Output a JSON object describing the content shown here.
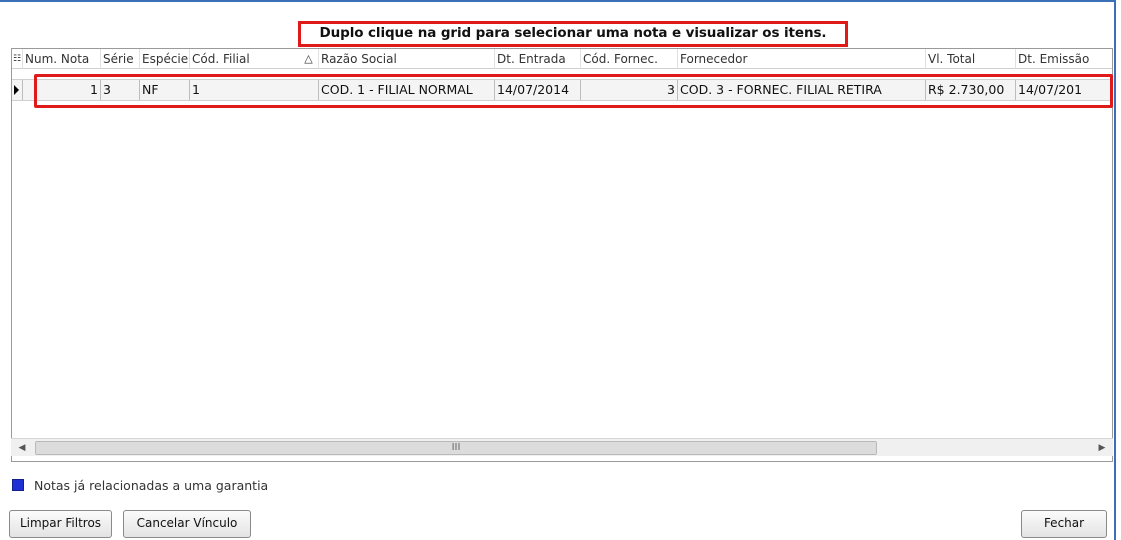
{
  "instruction": "Duplo clique na grid para selecionar uma nota e visualizar os itens.",
  "grid": {
    "columns": [
      {
        "key": "sel",
        "label": "☷"
      },
      {
        "key": "num_nota",
        "label": "Num. Nota"
      },
      {
        "key": "serie",
        "label": "Série"
      },
      {
        "key": "especie",
        "label": "Espécie"
      },
      {
        "key": "cod_filial",
        "label": "Cód. Filial"
      },
      {
        "key": "sort_indicator",
        "label": "△"
      },
      {
        "key": "razao_social",
        "label": "Razão Social"
      },
      {
        "key": "dt_entrada",
        "label": "Dt. Entrada"
      },
      {
        "key": "cod_fornec",
        "label": "Cód. Fornec."
      },
      {
        "key": "fornecedor",
        "label": "Fornecedor"
      },
      {
        "key": "vl_total",
        "label": "Vl. Total"
      },
      {
        "key": "dt_emissao",
        "label": "Dt. Emissão"
      }
    ],
    "rows": [
      {
        "num_nota": "1",
        "serie": "3",
        "especie": "NF",
        "cod_filial": "1",
        "razao_social": "COD. 1 - FILIAL NORMAL",
        "dt_entrada": "14/07/2014",
        "cod_fornec": "3",
        "fornecedor": "COD. 3 - FORNEC. FILIAL RETIRA",
        "vl_total": "R$ 2.730,00",
        "dt_emissao": "14/07/201"
      }
    ]
  },
  "scrollbar": {
    "thumb_glyph": "III",
    "left_glyph": "◀",
    "right_glyph": "▶"
  },
  "legend": {
    "label": "Notas já relacionadas a uma garantia",
    "color": "#1f2fd1"
  },
  "buttons": {
    "limpar_filtros": "Limpar Filtros",
    "cancelar_vinculo": "Cancelar Vínculo",
    "fechar": "Fechar"
  },
  "colors": {
    "highlight": "#e01919",
    "window_border": "#3b6fb6"
  }
}
